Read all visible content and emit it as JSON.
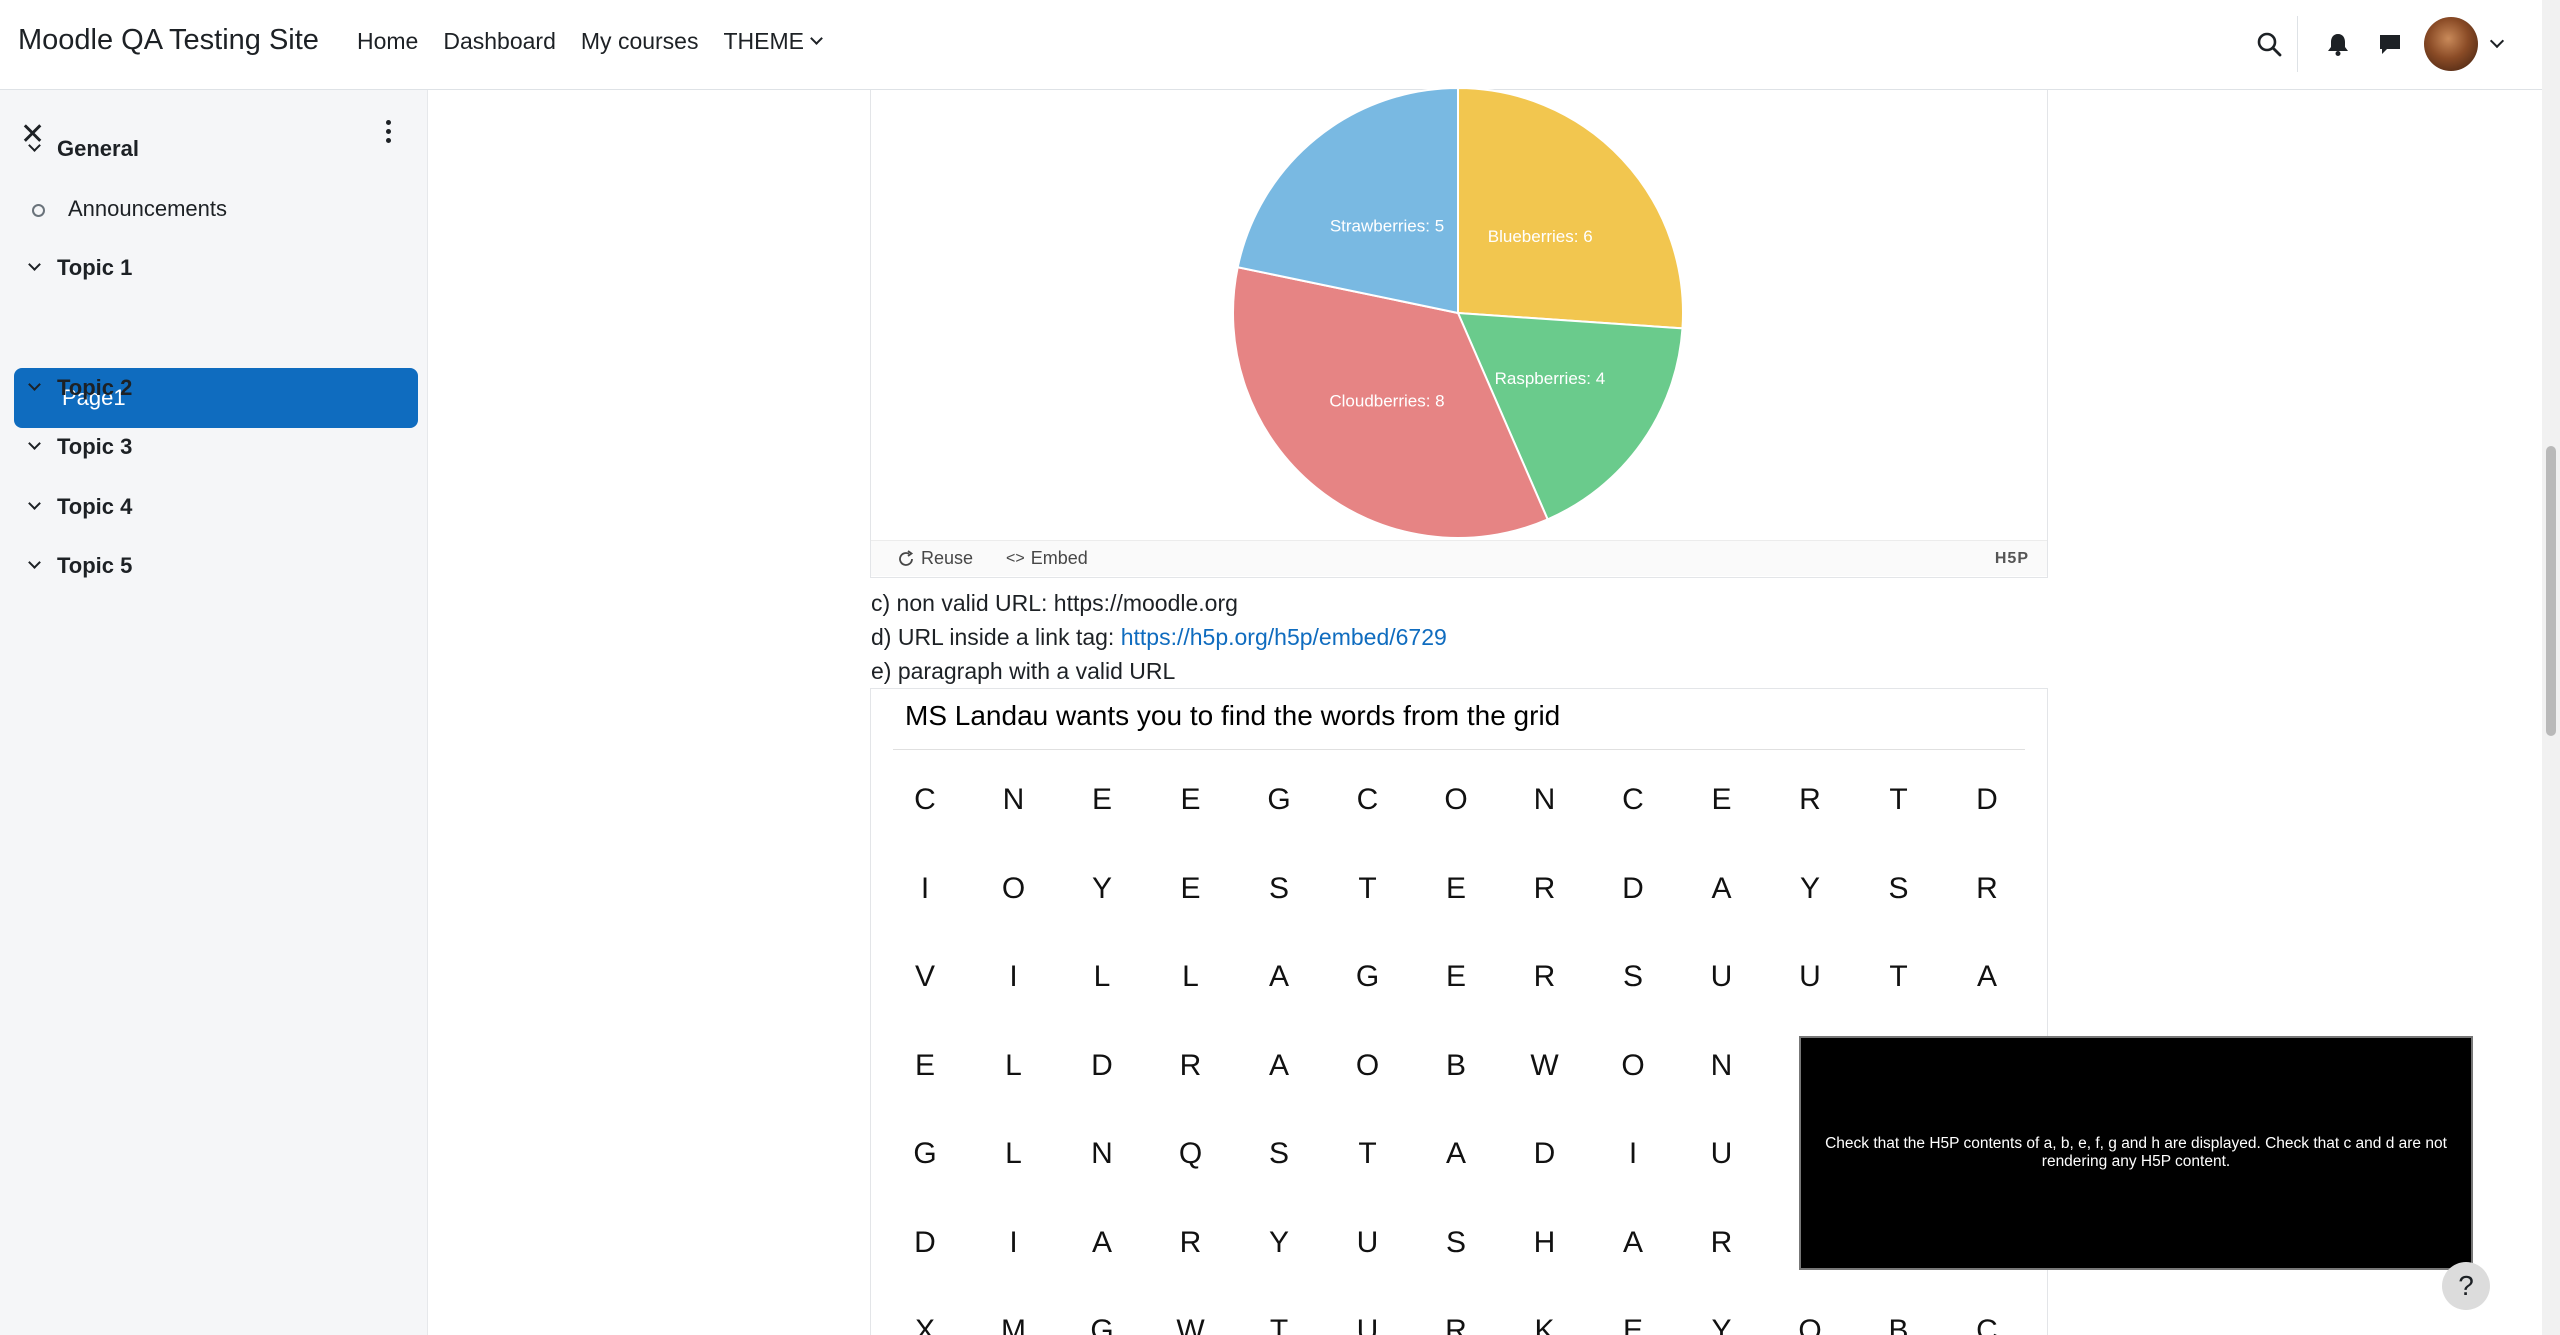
{
  "navbar": {
    "site_name": "Moodle QA Testing Site",
    "links": [
      "Home",
      "Dashboard",
      "My courses",
      "THEME"
    ]
  },
  "sidebar": {
    "items": [
      {
        "type": "section",
        "label": "General"
      },
      {
        "type": "activity",
        "label": "Announcements"
      },
      {
        "type": "section",
        "label": "Topic 1"
      },
      {
        "type": "active",
        "label": "Page1"
      },
      {
        "type": "section",
        "label": "Topic 2"
      },
      {
        "type": "section",
        "label": "Topic 3"
      },
      {
        "type": "section",
        "label": "Topic 4"
      },
      {
        "type": "section",
        "label": "Topic 5"
      }
    ]
  },
  "pie": {
    "slices": [
      {
        "label": "Blueberries: 6",
        "value": 6,
        "color": "#f2c64f"
      },
      {
        "label": "Raspberries: 4",
        "value": 4,
        "color": "#6acb8c"
      },
      {
        "label": "Cloudberries: 8",
        "value": 8,
        "color": "#e68484"
      },
      {
        "label": "Strawberries: 5",
        "value": 5,
        "color": "#79b9e2"
      }
    ]
  },
  "h5p_actions": {
    "reuse": "Reuse",
    "embed": "Embed",
    "logo": "H5P"
  },
  "paragraphs": {
    "c": "c) non valid URL: https://moodle.org",
    "d_prefix": "d) URL inside a link tag: ",
    "d_link": "https://h5p.org/h5p/embed/6729",
    "e": "e) paragraph with a valid URL"
  },
  "word_search": {
    "title": "MS Landau wants you to find the words from the grid",
    "rows": [
      [
        "C",
        "N",
        "E",
        "E",
        "G",
        "C",
        "O",
        "N",
        "C",
        "E",
        "R",
        "T",
        "D"
      ],
      [
        "I",
        "O",
        "Y",
        "E",
        "S",
        "T",
        "E",
        "R",
        "D",
        "A",
        "Y",
        "S",
        "R"
      ],
      [
        "V",
        "I",
        "L",
        "L",
        "A",
        "G",
        "E",
        "R",
        "S",
        "U",
        "U",
        "T",
        "A"
      ],
      [
        "E",
        "L",
        "D",
        "R",
        "A",
        "O",
        "B",
        "W",
        "O",
        "N",
        "",
        "",
        ""
      ],
      [
        "G",
        "L",
        "N",
        "Q",
        "S",
        "T",
        "A",
        "D",
        "I",
        "U",
        "",
        "",
        ""
      ],
      [
        "D",
        "I",
        "A",
        "R",
        "Y",
        "U",
        "S",
        "H",
        "A",
        "R",
        "",
        "",
        ""
      ],
      [
        "X",
        "M",
        "G",
        "W",
        "T",
        "U",
        "R",
        "K",
        "E",
        "Y",
        "O",
        "B",
        "C"
      ]
    ]
  },
  "overlay": {
    "text": "Check that the H5P contents of a, b, e, f, g and h are displayed. Check that c and d are not rendering any H5P content."
  },
  "help": "?"
}
